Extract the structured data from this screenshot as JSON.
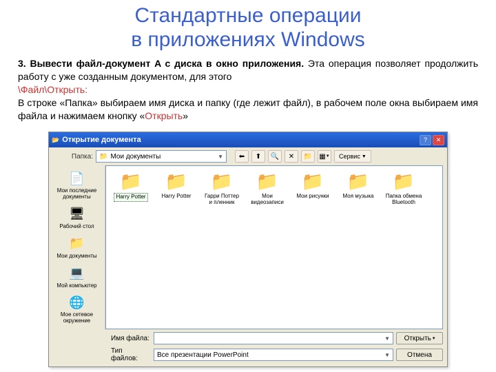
{
  "title": {
    "line1": "Стандартные операции",
    "line2": "в приложениях Windows"
  },
  "body": {
    "p1_bold": "3. Вывести файл-документ A с диска в окно приложения.",
    "p1_rest": " Эта операция позволяет продолжить работу с уже созданным документом, для этого",
    "menu_path": "\\Файл\\Открыть:",
    "p2_a": "В строке «Папка» выбираем имя диска и папку (где лежит файл), в рабочем поле окна выбираем имя файла и нажимаем кнопку «",
    "p2_hl": "Открыть",
    "p2_b": "»"
  },
  "dialog": {
    "title": "Открытие документа",
    "look_in_label": "Папка:",
    "look_in_value": "Мои документы",
    "tools_label": "Сервис",
    "places": [
      {
        "icon": "📄",
        "label": "Мои последние документы"
      },
      {
        "icon": "🖥",
        "label": "Рабочий стол"
      },
      {
        "icon": "📁",
        "label": "Мои документы"
      },
      {
        "icon": "💻",
        "label": "Мой компьютер"
      },
      {
        "icon": "🌐",
        "label": "Мое сетевое окружение"
      }
    ],
    "folders": [
      {
        "label": "Harry Potter",
        "selected": true
      },
      {
        "label": "Harry Potter"
      },
      {
        "label": "Гарри Поттер и пленник"
      },
      {
        "label": "Мои видеозаписи"
      },
      {
        "label": "Мои рисунки"
      },
      {
        "label": "Моя музыка"
      },
      {
        "label": "Папка обмена Bluetooth"
      }
    ],
    "filename_label": "Имя файла:",
    "filename_value": "",
    "filetype_label": "Тип файлов:",
    "filetype_value": "Все презентации PowerPoint",
    "open_btn": "Открыть",
    "cancel_btn": "Отмена"
  }
}
